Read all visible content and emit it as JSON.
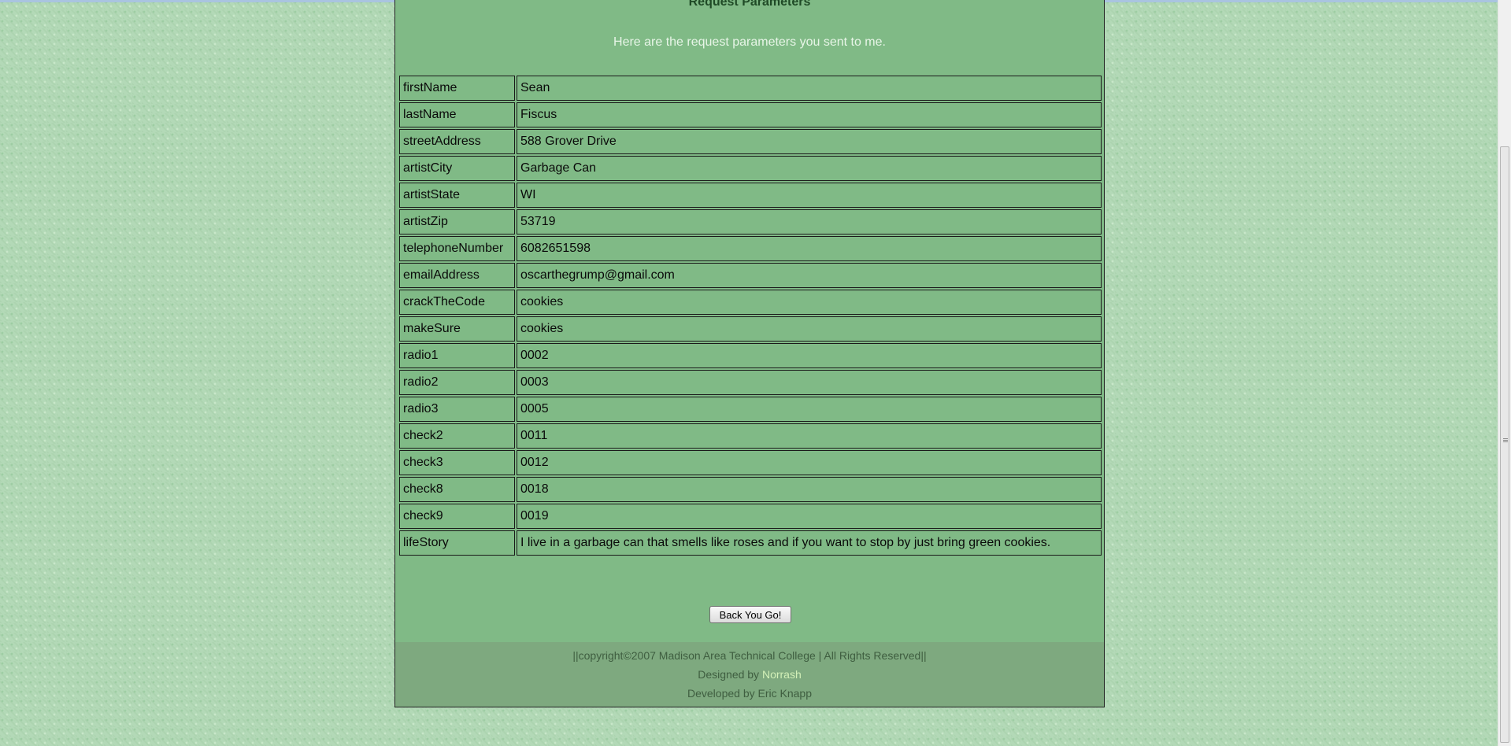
{
  "page": {
    "title": "Request Parameters",
    "intro": "Here are the request parameters you sent to me."
  },
  "params": [
    {
      "key": "firstName",
      "value": "Sean"
    },
    {
      "key": "lastName",
      "value": "Fiscus"
    },
    {
      "key": "streetAddress",
      "value": "588 Grover Drive"
    },
    {
      "key": "artistCity",
      "value": "Garbage Can"
    },
    {
      "key": "artistState",
      "value": "WI"
    },
    {
      "key": "artistZip",
      "value": "53719"
    },
    {
      "key": "telephoneNumber",
      "value": "6082651598"
    },
    {
      "key": "emailAddress",
      "value": "oscarthegrump@gmail.com"
    },
    {
      "key": "crackTheCode",
      "value": "cookies"
    },
    {
      "key": "makeSure",
      "value": "cookies"
    },
    {
      "key": "radio1",
      "value": "0002"
    },
    {
      "key": "radio2",
      "value": "0003"
    },
    {
      "key": "radio3",
      "value": "0005"
    },
    {
      "key": "check2",
      "value": "0011"
    },
    {
      "key": "check3",
      "value": "0012"
    },
    {
      "key": "check8",
      "value": "0018"
    },
    {
      "key": "check9",
      "value": "0019"
    },
    {
      "key": "lifeStory",
      "value": "I live in a garbage can that smells like roses and if you want to stop by just bring green cookies."
    }
  ],
  "back_button": "Back You Go!",
  "footer": {
    "copyright": "||copyright©2007 Madison Area Technical College | All Rights Reserved||",
    "designed_prefix": "Designed by ",
    "designer_link": "Norrash",
    "developed": "Developed by Eric Knapp"
  },
  "colors": {
    "page_background": "#b3d9b7",
    "container_background": "#80ba86",
    "footer_background": "#7ea97f",
    "link": "#d3f0b8"
  }
}
